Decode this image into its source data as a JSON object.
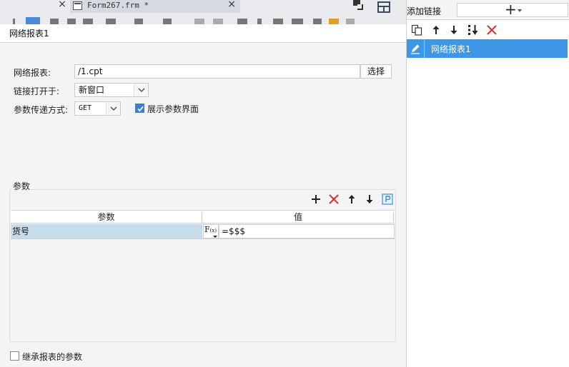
{
  "background_tab": {
    "title": "Form267.frm *",
    "close_label": "×"
  },
  "dialog": {
    "title": "网络报表1",
    "report_label": "网络报表:",
    "report_value": "/1.cpt",
    "select_button": "选择",
    "open_in_label": "链接打开于:",
    "open_in_value": "新窗口",
    "param_method_label": "参数传递方式:",
    "param_method_value": "GET",
    "show_params_label": "展示参数界面",
    "show_params_checked": true
  },
  "params": {
    "group_title": "参数",
    "columns": [
      "参数",
      "值"
    ],
    "rows": [
      {
        "name": "货号",
        "value": "=$$$"
      }
    ],
    "formula_button": "F(x)",
    "toolbar_icons": [
      "plus-icon",
      "delete-icon",
      "arrow-up-icon",
      "arrow-down-icon",
      "parameter-p-icon"
    ]
  },
  "inherit": {
    "label": "继承报表的参数",
    "checked": false
  },
  "link_panel": {
    "title": "添加链接",
    "add_label": "+",
    "toolbar_icons": [
      "copy-icon",
      "move-up-icon",
      "move-down-icon",
      "sort-icon",
      "delete-icon"
    ],
    "items": [
      {
        "label": "网络报表1",
        "selected": true
      }
    ]
  },
  "colors": {
    "accent": "#3d96e6",
    "delete_red": "#e02d2d",
    "row_highlight": "#c7dcea",
    "panel_bg": "#f4f4f6"
  }
}
